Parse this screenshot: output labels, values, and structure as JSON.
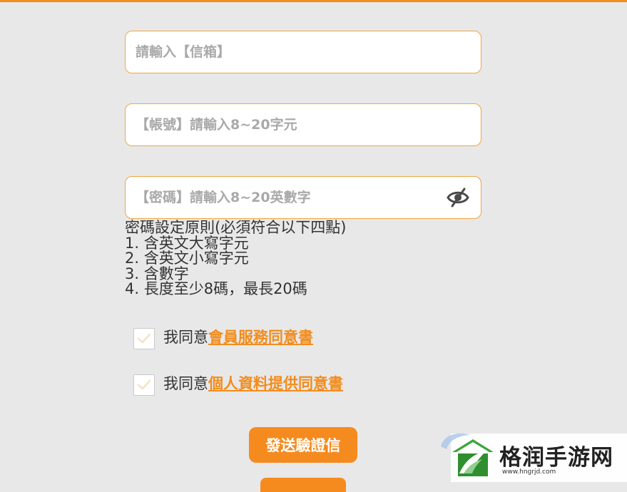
{
  "form": {
    "email_placeholder": "請輸入【信箱】",
    "account_placeholder": "【帳號】請輸入8~20字元",
    "password_placeholder": "【密碼】請輸入8~20英數字",
    "password_toggle_icon": "eye-off-icon"
  },
  "password_rules": {
    "title": "密碼設定原則(必須符合以下四點)",
    "items": [
      "1. 含英文大寫字元",
      "2. 含英文小寫字元",
      "3. 含數字",
      "4. 長度至少8碼，最長20碼"
    ]
  },
  "agreements": [
    {
      "prefix": "我同意",
      "link": "會員服務同意書",
      "checked": true
    },
    {
      "prefix": "我同意",
      "link": "個人資料提供同意書",
      "checked": true
    }
  ],
  "actions": {
    "send_verification_label": "發送驗證信"
  },
  "watermark": {
    "name": "格润手游网",
    "url": "www.hngrjd.com"
  },
  "colors": {
    "accent": "#f28c1c",
    "field_border": "#f0a640",
    "background": "#e8e8e8"
  }
}
